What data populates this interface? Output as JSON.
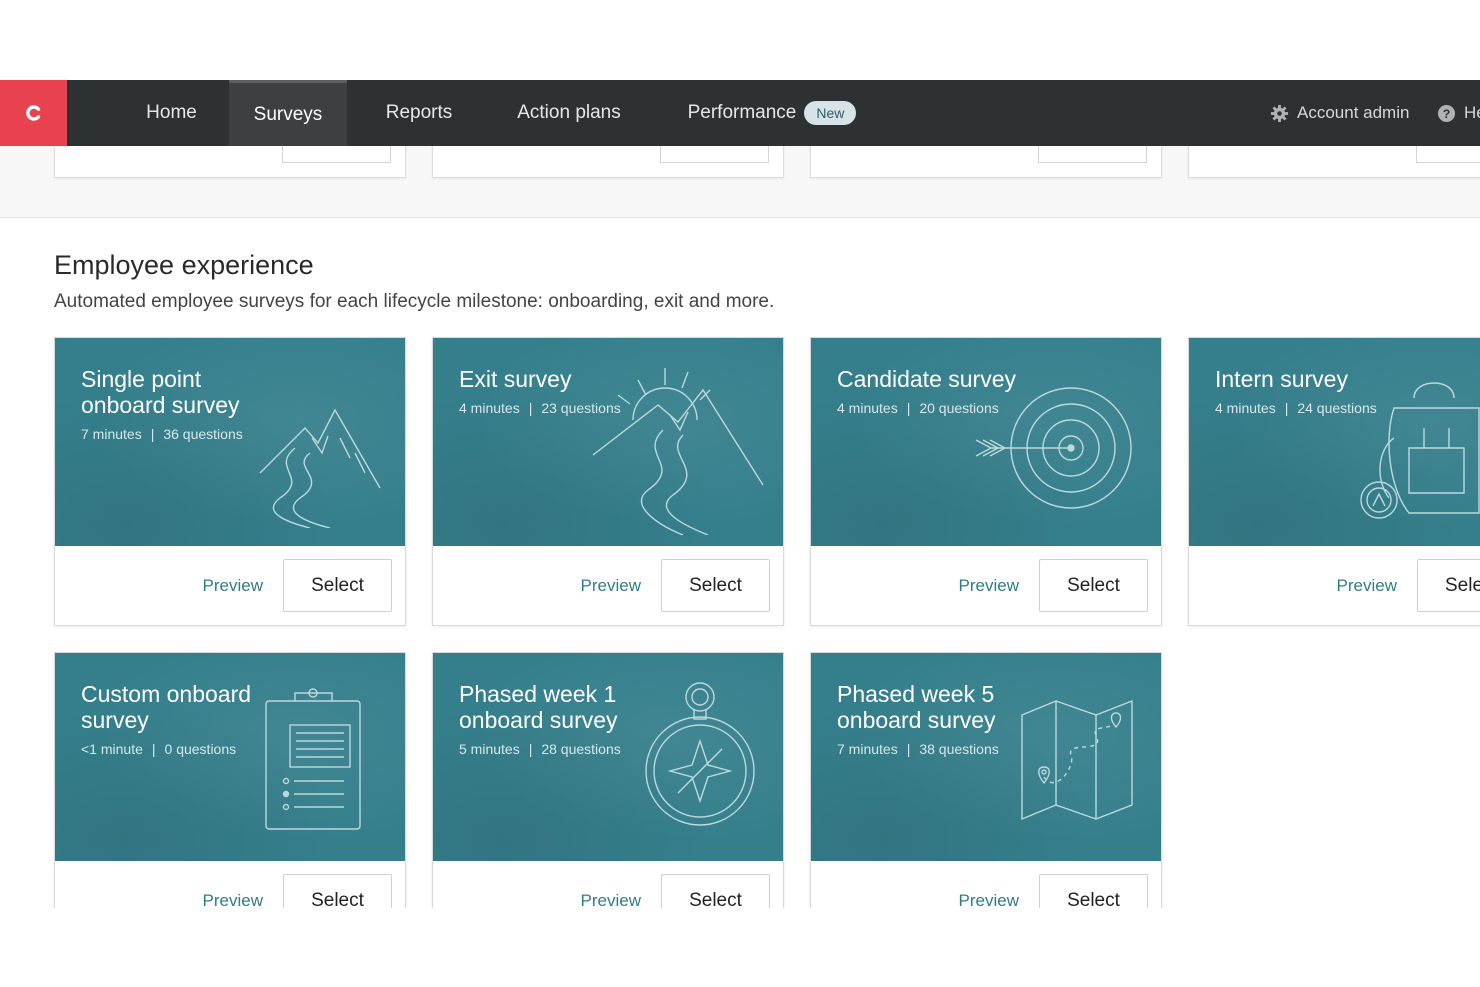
{
  "nav": {
    "logo": "C",
    "items": [
      {
        "label": "Home"
      },
      {
        "label": "Surveys"
      },
      {
        "label": "Reports"
      },
      {
        "label": "Action plans"
      },
      {
        "label": "Performance"
      }
    ],
    "badge": "New",
    "account": "Account admin",
    "help": "He"
  },
  "section": {
    "title": "Employee experience",
    "subtitle": "Automated employee surveys for each lifecycle milestone: onboarding, exit and more."
  },
  "cards": [
    {
      "title": "Single point onboard survey",
      "minutes": "7 minutes",
      "questions": "36 questions",
      "preview": "Preview",
      "select": "Select",
      "icon": "mountain-path-icon"
    },
    {
      "title": "Exit survey",
      "minutes": "4 minutes",
      "questions": "23 questions",
      "preview": "Preview",
      "select": "Select",
      "icon": "sunset-mountain-icon"
    },
    {
      "title": "Candidate survey",
      "minutes": "4 minutes",
      "questions": "20 questions",
      "preview": "Preview",
      "select": "Select",
      "icon": "target-arrow-icon"
    },
    {
      "title": "Intern survey",
      "minutes": "4 minutes",
      "questions": "24 questions",
      "preview": "Preview",
      "select": "Sele",
      "icon": "backpack-icon"
    },
    {
      "title": "Custom onboard survey",
      "minutes": "<1 minute",
      "questions": "0 questions",
      "preview": "Preview",
      "select": "Select",
      "icon": "clipboard-icon"
    },
    {
      "title": "Phased week 1 onboard survey",
      "minutes": "5 minutes",
      "questions": "28 questions",
      "preview": "Preview",
      "select": "Select",
      "icon": "compass-icon"
    },
    {
      "title": "Phased week 5 onboard survey",
      "minutes": "7 minutes",
      "questions": "38 questions",
      "preview": "Preview",
      "select": "Select",
      "icon": "map-icon"
    }
  ],
  "colors": {
    "nav_bg": "#2e3133",
    "logo_bg": "#e8414f",
    "card_teal": "#357f8c",
    "link": "#2f7d8a"
  }
}
